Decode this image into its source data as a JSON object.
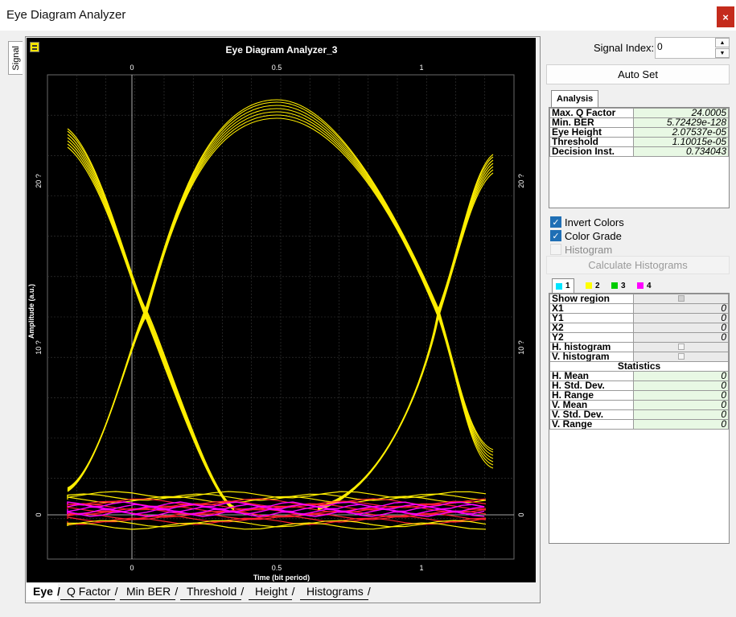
{
  "window": {
    "title": "Eye Diagram Analyzer",
    "close_glyph": "×"
  },
  "side_tab": {
    "label": "Signal"
  },
  "plot": {
    "title": "Eye Diagram Analyzer_3",
    "x_label": "Time (bit period)",
    "y_label": "Amplitude (a.u.)",
    "x_ticks": [
      "0",
      "0.5",
      "1"
    ],
    "y_ticks": [
      "0",
      "10 ?",
      "20 ?"
    ],
    "colors": {
      "background": "#000000",
      "grid": "#3a3a3a",
      "trace": "#ffee00",
      "hot": "#ff2030",
      "core": "#ff00ff"
    }
  },
  "bottom_tabs": [
    "Eye",
    "Q Factor",
    "Min BER",
    "Threshold",
    "Height",
    "Histograms"
  ],
  "right": {
    "signal_index_label": "Signal Index:",
    "signal_index_value": "0",
    "auto_set_label": "Auto Set",
    "analysis_tab": "Analysis",
    "analysis_rows": [
      {
        "k": "Max. Q Factor",
        "v": "24.0005"
      },
      {
        "k": "Min. BER",
        "v": "5.72429e-128"
      },
      {
        "k": "Eye Height",
        "v": "2.07537e-05"
      },
      {
        "k": "Threshold",
        "v": "1.10015e-05"
      },
      {
        "k": "Decision Inst.",
        "v": "0.734043"
      }
    ],
    "invert_colors": "Invert Colors",
    "color_grade": "Color Grade",
    "histogram": "Histogram",
    "calc_hist": "Calculate Histograms",
    "color_tabs": [
      {
        "label": "1",
        "color": "#00e5ff"
      },
      {
        "label": "2",
        "color": "#ffff00"
      },
      {
        "label": "3",
        "color": "#00cc00"
      },
      {
        "label": "4",
        "color": "#ff00ff"
      }
    ],
    "region_rows": [
      {
        "k": "Show region",
        "v": ""
      },
      {
        "k": "X1",
        "v": "0"
      },
      {
        "k": "Y1",
        "v": "0"
      },
      {
        "k": "X2",
        "v": "0"
      },
      {
        "k": "Y2",
        "v": "0"
      },
      {
        "k": "H. histogram",
        "v": ""
      },
      {
        "k": "V. histogram",
        "v": ""
      }
    ],
    "statistics_label": "Statistics",
    "stat_rows": [
      {
        "k": "H. Mean",
        "v": "0"
      },
      {
        "k": "H. Std. Dev.",
        "v": "0"
      },
      {
        "k": "H. Range",
        "v": "0"
      },
      {
        "k": "V. Mean",
        "v": "0"
      },
      {
        "k": "V. Std. Dev.",
        "v": "0"
      },
      {
        "k": "V. Range",
        "v": "0"
      }
    ]
  }
}
